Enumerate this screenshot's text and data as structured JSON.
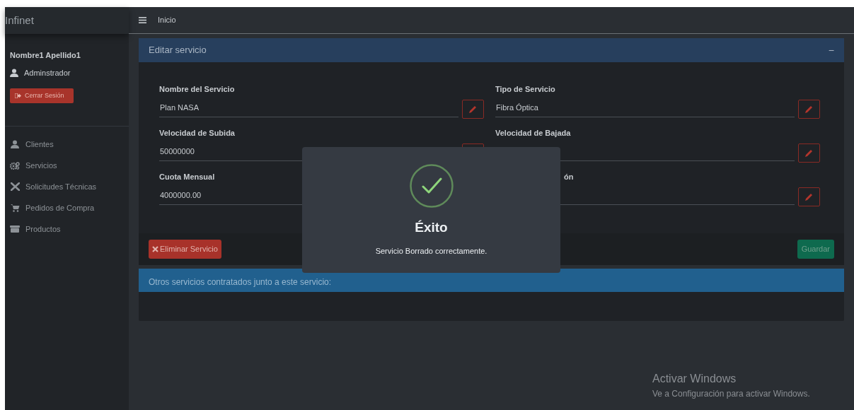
{
  "brand": "Infinet",
  "user": {
    "name": "Nombre1 Apellido1",
    "role": "Adminstrador",
    "logout": "Cerrar Sesión"
  },
  "sidebar": {
    "items": [
      {
        "label": "Clientes"
      },
      {
        "label": "Servicios"
      },
      {
        "label": "Solicitudes Técnicas"
      },
      {
        "label": "Pedidos de Compra"
      },
      {
        "label": "Productos"
      }
    ]
  },
  "topbar": {
    "title": "Inicio"
  },
  "edit_card": {
    "title": "Editar servicio",
    "collapse": "−",
    "fields": [
      {
        "label": "Nombre del Servicio",
        "value": "Plan NASA",
        "edit_button": true
      },
      {
        "label": "Tipo de Servicio",
        "value": "Fibra Óptica",
        "edit_button": true
      },
      {
        "label": "Velocidad de Subida",
        "value": "50000000",
        "edit_button": true,
        "button_covered": true
      },
      {
        "label": "Velocidad de Bajada",
        "edit_button": true
      },
      {
        "label": "Cuota Mensual",
        "value": "4000000.00",
        "edit_button": false
      },
      {
        "label": "ón",
        "covered": true,
        "edit_button": true
      }
    ],
    "delete_button": "Eliminar Servicio",
    "save_button": "Guardar"
  },
  "other_card": {
    "title": "Otros servicios contratados junto a este servicio:"
  },
  "dialog": {
    "title": "Éxito",
    "message": "Servicio Borrado correctamente."
  },
  "os_notice": {
    "title": "Activar Windows",
    "message": "Ve a Configuración para activar Windows."
  }
}
